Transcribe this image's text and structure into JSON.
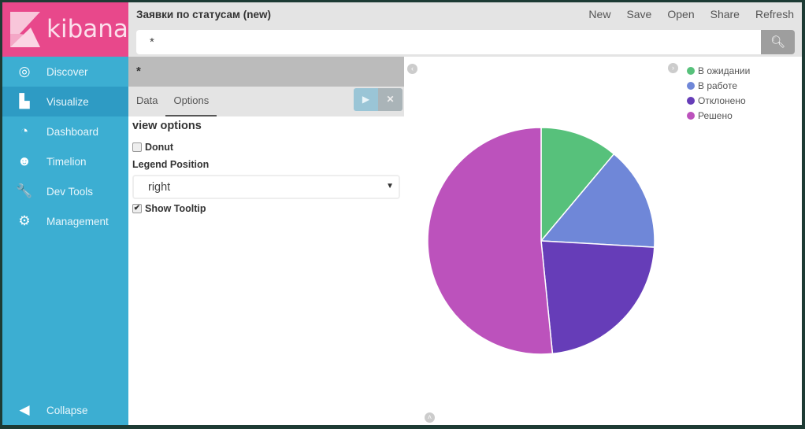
{
  "sidebar": {
    "logo": "kibana",
    "items": [
      {
        "label": "Discover",
        "icon": "compass-icon"
      },
      {
        "label": "Visualize",
        "icon": "bar-chart-icon",
        "active": true
      },
      {
        "label": "Dashboard",
        "icon": "dashboard-icon"
      },
      {
        "label": "Timelion",
        "icon": "timelion-icon"
      },
      {
        "label": "Dev Tools",
        "icon": "wrench-icon"
      },
      {
        "label": "Management",
        "icon": "gear-icon"
      }
    ],
    "collapse": "Collapse"
  },
  "header": {
    "title": "Заявки по статусам (new)",
    "actions": [
      "New",
      "Save",
      "Open",
      "Share",
      "Refresh"
    ],
    "search_value": "*"
  },
  "editor": {
    "query": "*",
    "tabs": [
      "Data",
      "Options"
    ],
    "active_tab": "Options",
    "options": {
      "heading": "view options",
      "donut_label": "Donut",
      "donut": false,
      "legend_position_label": "Legend Position",
      "legend_position": "right",
      "show_tooltip_label": "Show Tooltip",
      "show_tooltip": true
    }
  },
  "chart_data": {
    "type": "pie",
    "legend_position": "right",
    "categories": [
      "В ожидании",
      "В работе",
      "Отклонено",
      "Решено"
    ],
    "values": [
      11.1,
      14.8,
      22.5,
      51.6
    ],
    "colors": [
      "#57c17b",
      "#6f87d8",
      "#663db8",
      "#bc52bc"
    ]
  }
}
